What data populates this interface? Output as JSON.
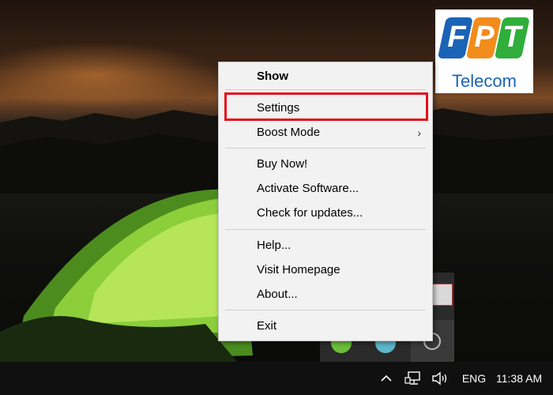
{
  "menu": {
    "items": [
      {
        "label": "Show",
        "bold": true
      },
      {
        "label": "Settings",
        "highlighted": true
      },
      {
        "label": "Boost Mode",
        "submenu": true
      },
      {
        "label": "Buy Now!"
      },
      {
        "label": "Activate Software..."
      },
      {
        "label": "Check for updates..."
      },
      {
        "label": "Help..."
      },
      {
        "label": "Visit Homepage"
      },
      {
        "label": "About..."
      },
      {
        "label": "Exit"
      }
    ],
    "submenu_arrow": "›",
    "highlight_color": "#e3101a"
  },
  "logo": {
    "letters": [
      "F",
      "P",
      "T"
    ],
    "subtitle": "Telecom",
    "colors": {
      "f": "#1b63b5",
      "p": "#f28c1b",
      "t": "#2fae3b"
    }
  },
  "taskbar": {
    "chevron": "^",
    "lang": "ENG",
    "clock": "11:38 AM",
    "icons": [
      "chevron-up-icon",
      "network-icon",
      "volume-icon"
    ]
  }
}
